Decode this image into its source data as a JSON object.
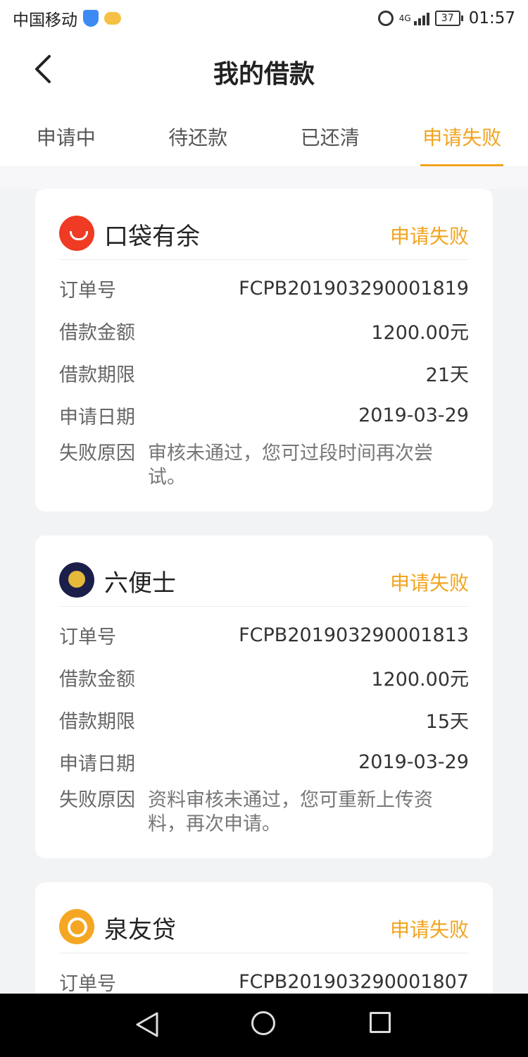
{
  "status_bar": {
    "carrier": "中国移动",
    "network": "4G",
    "battery": "37",
    "time": "01:57"
  },
  "header": {
    "title": "我的借款"
  },
  "tabs": [
    {
      "label": "申请中",
      "active": false
    },
    {
      "label": "待还款",
      "active": false
    },
    {
      "label": "已还清",
      "active": false
    },
    {
      "label": "申请失败",
      "active": true
    }
  ],
  "labels": {
    "order_no": "订单号",
    "amount": "借款金额",
    "term": "借款期限",
    "date": "申请日期",
    "reason": "失败原因"
  },
  "loans": [
    {
      "lender": "口袋有余",
      "status": "申请失败",
      "order_no": "FCPB201903290001819",
      "amount": "1200.00元",
      "term": "21天",
      "date": "2019-03-29",
      "reason": "审核未通过，您可过段时间再次尝试。"
    },
    {
      "lender": "六便士",
      "status": "申请失败",
      "order_no": "FCPB201903290001813",
      "amount": "1200.00元",
      "term": "15天",
      "date": "2019-03-29",
      "reason": "资料审核未通过，您可重新上传资料，再次申请。"
    },
    {
      "lender": "泉友贷",
      "status": "申请失败",
      "order_no": "FCPB201903290001807"
    }
  ],
  "colors": {
    "accent": "#f0a41f",
    "background": "#f2f3f5"
  },
  "icons": {
    "back": "chevron-left-icon",
    "nav_back": "triangle-back-icon",
    "nav_home": "circle-home-icon",
    "nav_recent": "square-recent-icon"
  }
}
